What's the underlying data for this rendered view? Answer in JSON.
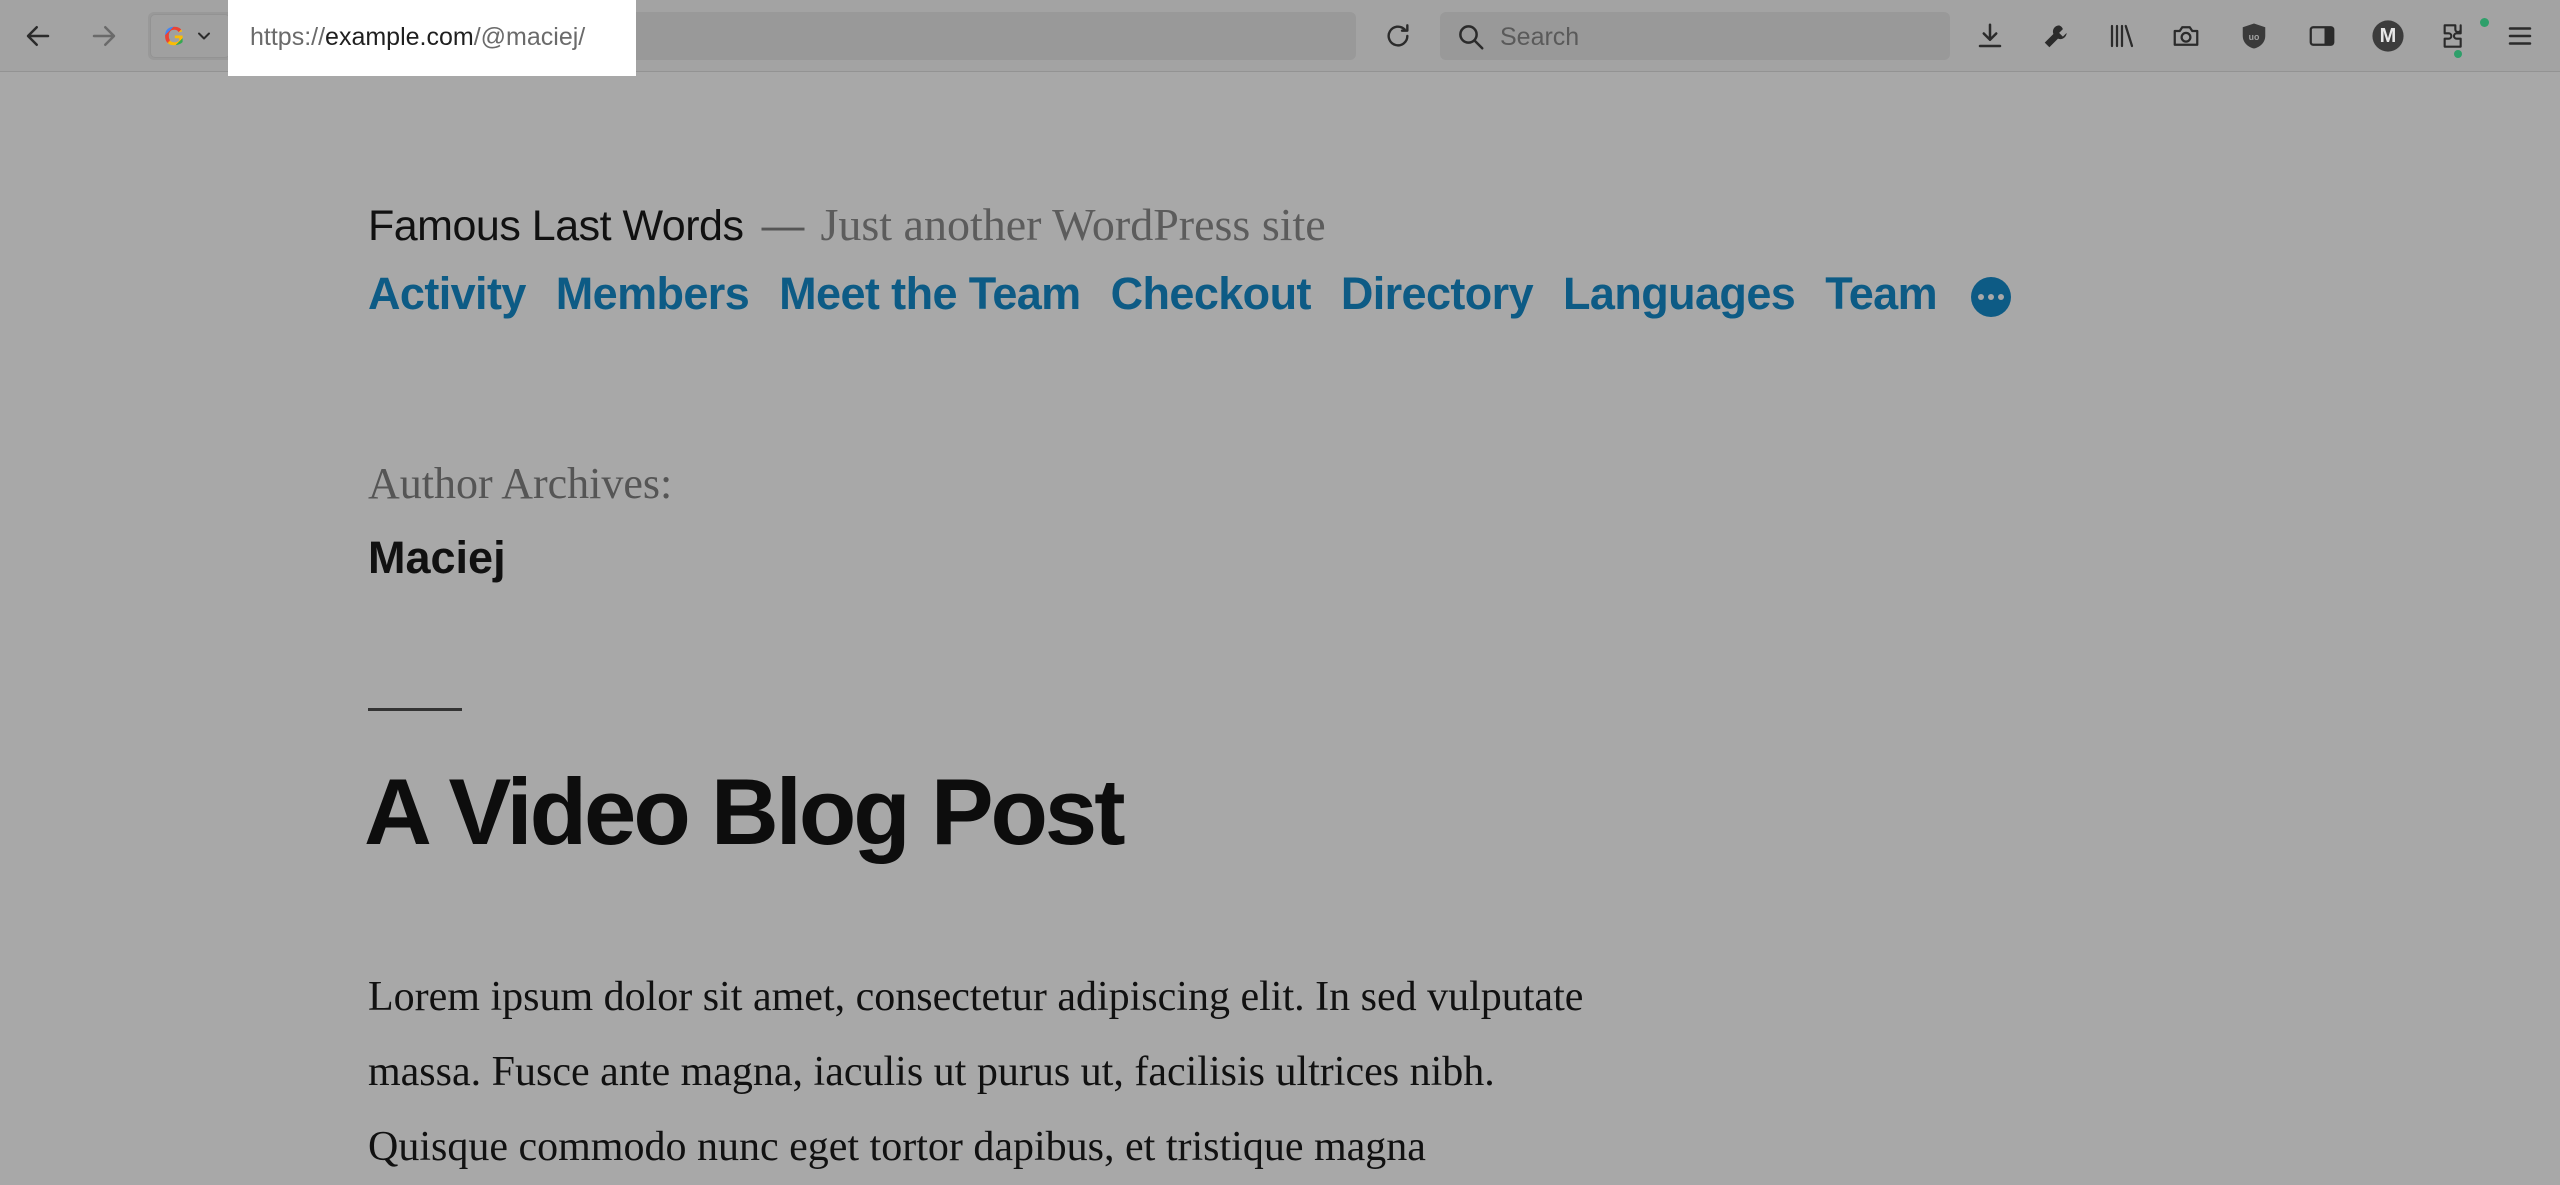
{
  "browser": {
    "url_prefix": "https://",
    "url_host": "example.com",
    "url_path": "/@maciej/",
    "search_placeholder": "Search",
    "profile_initial": "M",
    "search_engine_letter": "G"
  },
  "site": {
    "title": "Famous Last Words",
    "dash": "—",
    "tagline": "Just another WordPress site"
  },
  "nav": {
    "items": [
      "Activity",
      "Members",
      "Meet the Team",
      "Checkout",
      "Directory",
      "Languages",
      "Team"
    ]
  },
  "archive": {
    "label": "Author Archives:",
    "name": "Maciej"
  },
  "post": {
    "title": "A Video Blog Post",
    "excerpt": "Lorem ipsum dolor sit amet, consectetur adipiscing elit. In sed vulputate massa. Fusce ante magna, iaculis ut purus ut, facilisis ultrices nibh. Quisque commodo nunc eget tortor dapibus, et tristique magna"
  },
  "colors": {
    "link": "#0d5b85",
    "overlay_bg": "#a8a8a8"
  }
}
